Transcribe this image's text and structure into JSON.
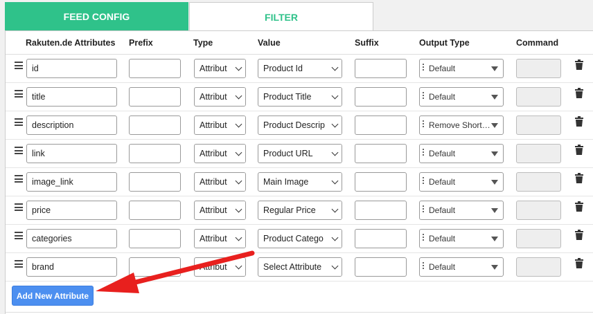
{
  "tabs": {
    "feed_config": "FEED CONFIG",
    "filter": "FILTER"
  },
  "table": {
    "headers": [
      "Rakuten.de Attributes",
      "Prefix",
      "Type",
      "Value",
      "Suffix",
      "Output Type",
      "Command"
    ],
    "rows": [
      {
        "attribute": "id",
        "prefix": "",
        "type": "Attribut",
        "value": "Product Id",
        "suffix": "",
        "output_type": "Default",
        "command": ""
      },
      {
        "attribute": "title",
        "prefix": "",
        "type": "Attribut",
        "value": "Product Title",
        "suffix": "",
        "output_type": "Default",
        "command": ""
      },
      {
        "attribute": "description",
        "prefix": "",
        "type": "Attribut",
        "value": "Product Descrip",
        "suffix": "",
        "output_type": "Remove Short…",
        "command": ""
      },
      {
        "attribute": "link",
        "prefix": "",
        "type": "Attribut",
        "value": "Product URL",
        "suffix": "",
        "output_type": "Default",
        "command": ""
      },
      {
        "attribute": "image_link",
        "prefix": "",
        "type": "Attribut",
        "value": "Main Image",
        "suffix": "",
        "output_type": "Default",
        "command": ""
      },
      {
        "attribute": "price",
        "prefix": "",
        "type": "Attribut",
        "value": "Regular Price",
        "suffix": "",
        "output_type": "Default",
        "command": ""
      },
      {
        "attribute": "categories",
        "prefix": "",
        "type": "Attribut",
        "value": "Product Catego",
        "suffix": "",
        "output_type": "Default",
        "command": ""
      },
      {
        "attribute": "brand",
        "prefix": "",
        "type": "Attribut",
        "value": "Select Attribute",
        "suffix": "",
        "output_type": "Default",
        "command": ""
      }
    ]
  },
  "add_button_label": "Add New Attribute",
  "colors": {
    "tab_active": "#2fc28a",
    "button": "#4c8ff0",
    "annotation_arrow": "#e8201e"
  },
  "icons": {
    "drag_handle": "hamburger-icon",
    "delete": "trash-icon",
    "dropdown": "chevron-down-icon"
  }
}
